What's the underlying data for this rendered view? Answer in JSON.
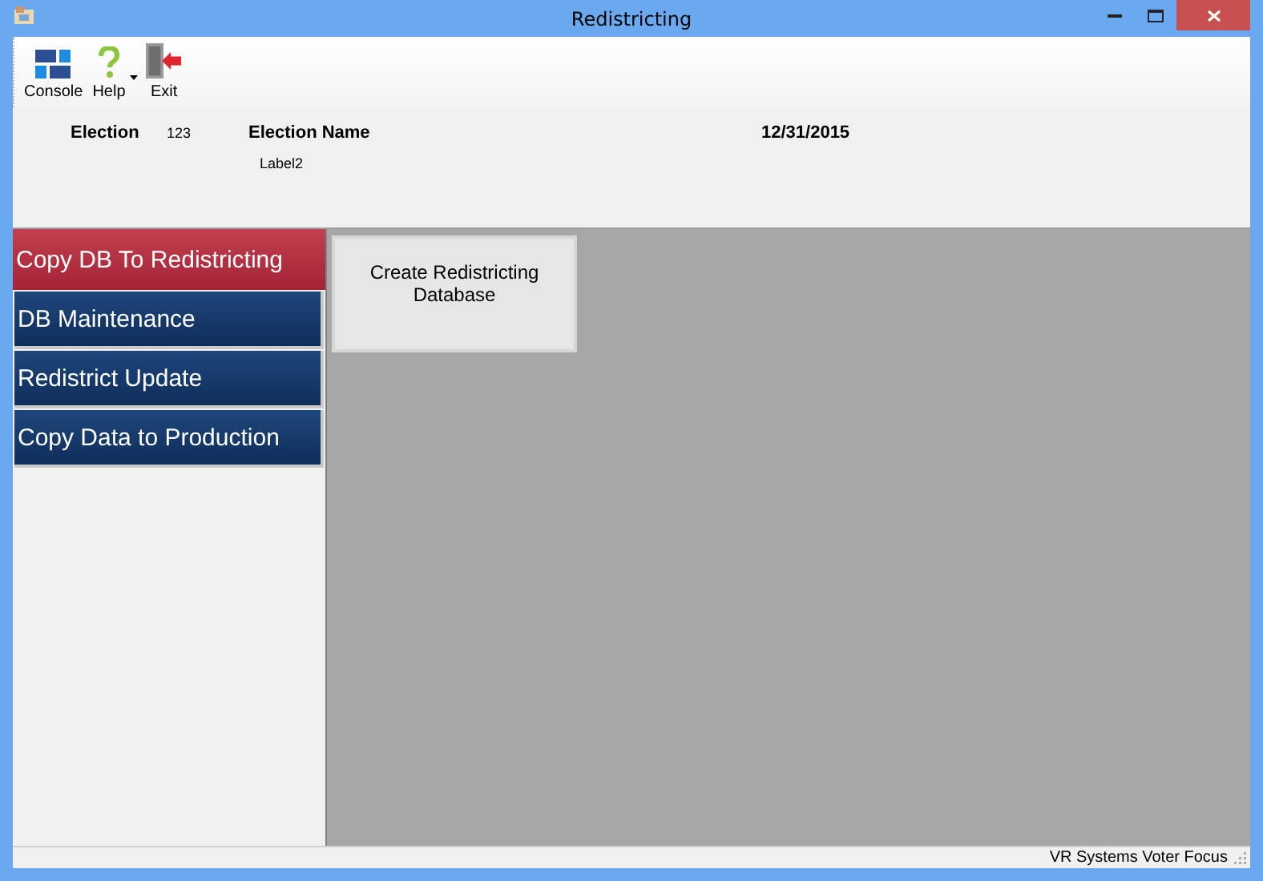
{
  "window": {
    "title": "Redistricting"
  },
  "toolbar": [
    {
      "label": "Console",
      "kind": "console",
      "dropdown": false
    },
    {
      "label": "Help",
      "kind": "help",
      "dropdown": true
    },
    {
      "label": "Exit",
      "kind": "exit",
      "dropdown": false
    }
  ],
  "header": {
    "election_label": "Election",
    "election_number": "123",
    "election_name_label": "Election Name",
    "election_name": "Label2",
    "date": "12/31/2015"
  },
  "nav": [
    {
      "label": "Copy DB To Redistricting",
      "selected": true
    },
    {
      "label": "DB Maintenance",
      "selected": false
    },
    {
      "label": "Redistrict Update",
      "selected": false
    },
    {
      "label": "Copy Data to Production",
      "selected": false
    }
  ],
  "actions": [
    "Create Redistricting\nDatabase"
  ],
  "status_bar": "VR Systems Voter Focus"
}
